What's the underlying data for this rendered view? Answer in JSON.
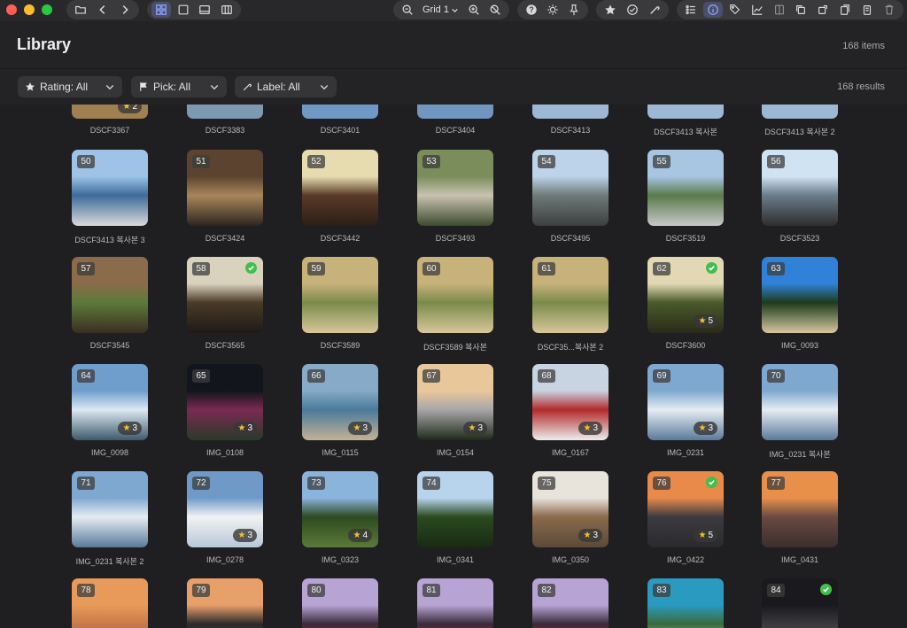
{
  "toolbar": {
    "grid_label": "Grid 1",
    "icons": [
      "folder-icon",
      "back-icon",
      "forward-icon",
      "grid-view-icon",
      "single-view-icon",
      "filmstrip-view-icon",
      "compare-view-icon",
      "zoom-out-icon",
      "zoom-in-icon",
      "zoom-reset-icon",
      "help-icon",
      "brightness-icon",
      "pin-icon",
      "star-icon",
      "check-icon",
      "eyedropper-icon",
      "list-icon",
      "info-icon",
      "tags-icon",
      "histogram-icon",
      "panel-icon",
      "copy-icon",
      "crop-icon",
      "paste-icon",
      "duplicate-icon",
      "trash-icon"
    ]
  },
  "header": {
    "title": "Library",
    "count": "168 items"
  },
  "filters": {
    "rating": "Rating: All",
    "pick": "Pick: All",
    "label": "Label: All",
    "results": "168 results"
  },
  "grid": {
    "partial_row": [
      {
        "name": "DSCF3367",
        "stars": "2",
        "colors": [
          "#6b5a3c",
          "#a08050"
        ]
      },
      {
        "name": "DSCF3383",
        "stars": "",
        "colors": [
          "#4a5f74",
          "#7d9ab3"
        ]
      },
      {
        "name": "DSCF3401",
        "stars": "",
        "colors": [
          "#3f6a95",
          "#6f98c4"
        ]
      },
      {
        "name": "DSCF3404",
        "stars": "",
        "colors": [
          "#3d5f8a",
          "#7197c0"
        ]
      },
      {
        "name": "DSCF3413",
        "stars": "",
        "colors": [
          "#5a7fa3",
          "#9bb9d4"
        ]
      },
      {
        "name": "DSCF3413 복사본",
        "stars": "",
        "colors": [
          "#5a7fa3",
          "#9bb9d4"
        ]
      },
      {
        "name": "DSCF3413 복사본 2",
        "stars": "",
        "colors": [
          "#5a7fa3",
          "#9bb9d4"
        ]
      }
    ],
    "rows": [
      [
        {
          "num": "50",
          "name": "DSCF3413 복사본 3",
          "stars": "",
          "check": false,
          "colors": [
            "#9ec3e6",
            "#3d6b9b",
            "#d9d9d9"
          ]
        },
        {
          "num": "51",
          "name": "DSCF3424",
          "stars": "",
          "check": false,
          "colors": [
            "#5b4330",
            "#a9865a",
            "#2d2520"
          ]
        },
        {
          "num": "52",
          "name": "DSCF3442",
          "stars": "",
          "check": false,
          "colors": [
            "#e6dcb0",
            "#5a3a28",
            "#2b1e17"
          ]
        },
        {
          "num": "53",
          "name": "DSCF3493",
          "stars": "",
          "check": false,
          "colors": [
            "#7a8d5a",
            "#c9c2b0",
            "#3c4a2e"
          ]
        },
        {
          "num": "54",
          "name": "DSCF3495",
          "stars": "",
          "check": false,
          "colors": [
            "#bcd3ea",
            "#6f7a78",
            "#3c3f40"
          ]
        },
        {
          "num": "55",
          "name": "DSCF3519",
          "stars": "",
          "check": false,
          "colors": [
            "#a8c5e2",
            "#5a7a4a",
            "#c8c8c8"
          ]
        },
        {
          "num": "56",
          "name": "DSCF3523",
          "stars": "",
          "check": false,
          "colors": [
            "#cfe3f2",
            "#6a7c8a",
            "#2d2d2d"
          ]
        }
      ],
      [
        {
          "num": "57",
          "name": "DSCF3545",
          "stars": "",
          "check": false,
          "colors": [
            "#8a6b4a",
            "#5c7a3a",
            "#3b2e22"
          ]
        },
        {
          "num": "58",
          "name": "DSCF3565",
          "stars": "",
          "check": true,
          "colors": [
            "#d9d2bd",
            "#4a3a28",
            "#1e1a16"
          ]
        },
        {
          "num": "59",
          "name": "DSCF3589",
          "stars": "",
          "check": false,
          "colors": [
            "#c7b27a",
            "#7a8a4a",
            "#d9c79a"
          ]
        },
        {
          "num": "60",
          "name": "DSCF3589 복사본",
          "stars": "",
          "check": false,
          "colors": [
            "#c7b27a",
            "#7a8a4a",
            "#d9c79a"
          ]
        },
        {
          "num": "61",
          "name": "DSCF35...복사본 2",
          "stars": "",
          "check": false,
          "colors": [
            "#c7b27a",
            "#7a8a4a",
            "#d9c79a"
          ]
        },
        {
          "num": "62",
          "name": "DSCF3600",
          "stars": "5",
          "check": true,
          "colors": [
            "#e2d8b4",
            "#4a5a2a",
            "#2a2a1a"
          ]
        },
        {
          "num": "63",
          "name": "IMG_0093",
          "stars": "",
          "check": false,
          "colors": [
            "#2f82d8",
            "#1d3a1a",
            "#d6c6a0"
          ]
        }
      ],
      [
        {
          "num": "64",
          "name": "IMG_0098",
          "stars": "3",
          "check": false,
          "colors": [
            "#6f9dcc",
            "#dce8f2",
            "#3d5a6a"
          ]
        },
        {
          "num": "65",
          "name": "IMG_0108",
          "stars": "3",
          "check": false,
          "colors": [
            "#12151c",
            "#7a2a52",
            "#2a3a2a"
          ]
        },
        {
          "num": "66",
          "name": "IMG_0115",
          "stars": "3",
          "check": false,
          "colors": [
            "#86aac8",
            "#4a7a9a",
            "#c4b294"
          ]
        },
        {
          "num": "67",
          "name": "IMG_0154",
          "stars": "3",
          "check": false,
          "colors": [
            "#e8c89a",
            "#a8a6a8",
            "#1e2a1a"
          ]
        },
        {
          "num": "68",
          "name": "IMG_0167",
          "stars": "3",
          "check": false,
          "colors": [
            "#c8d4e2",
            "#b22a2a",
            "#ededed"
          ]
        },
        {
          "num": "69",
          "name": "IMG_0231",
          "stars": "3",
          "check": false,
          "colors": [
            "#7fa8d0",
            "#e6ecf2",
            "#5a7a9a"
          ]
        },
        {
          "num": "70",
          "name": "IMG_0231 복사본",
          "stars": "",
          "check": false,
          "colors": [
            "#7fa8d0",
            "#e6ecf2",
            "#5a7a9a"
          ]
        }
      ],
      [
        {
          "num": "71",
          "name": "IMG_0231 복사본 2",
          "stars": "",
          "check": false,
          "colors": [
            "#7fa8d0",
            "#e6ecf2",
            "#5a7a9a"
          ]
        },
        {
          "num": "72",
          "name": "IMG_0278",
          "stars": "3",
          "check": false,
          "colors": [
            "#6f9ac8",
            "#f2f2f2",
            "#b8c8d8"
          ]
        },
        {
          "num": "73",
          "name": "IMG_0323",
          "stars": "4",
          "check": false,
          "colors": [
            "#8ab4dc",
            "#2d4a1e",
            "#5a7a3a"
          ]
        },
        {
          "num": "74",
          "name": "IMG_0341",
          "stars": "",
          "check": false,
          "colors": [
            "#b8d4ec",
            "#2a4a1e",
            "#1a2a14"
          ]
        },
        {
          "num": "75",
          "name": "IMG_0350",
          "stars": "3",
          "check": false,
          "colors": [
            "#e8e4dc",
            "#8a6a4a",
            "#5a4a3a"
          ]
        },
        {
          "num": "76",
          "name": "IMG_0422",
          "stars": "5",
          "check": true,
          "colors": [
            "#e88a4a",
            "#3a3a40",
            "#2a2a2e"
          ]
        },
        {
          "num": "77",
          "name": "IMG_0431",
          "stars": "",
          "check": false,
          "colors": [
            "#e8904a",
            "#6a4a42",
            "#3a2e2e"
          ]
        }
      ],
      [
        {
          "num": "78",
          "name": "",
          "stars": "",
          "check": false,
          "colors": [
            "#e89a5a",
            "#c87a4a",
            "#6a5a6a"
          ]
        },
        {
          "num": "79",
          "name": "",
          "stars": "",
          "check": false,
          "colors": [
            "#e8a06a",
            "#2a2a2a",
            "#5a4a3a"
          ]
        },
        {
          "num": "80",
          "name": "",
          "stars": "",
          "check": false,
          "colors": [
            "#b8a4d4",
            "#3a2a3a",
            "#c83a3a"
          ]
        },
        {
          "num": "81",
          "name": "",
          "stars": "",
          "check": false,
          "colors": [
            "#b8a4d4",
            "#3a2a3a",
            "#c83a3a"
          ]
        },
        {
          "num": "82",
          "name": "",
          "stars": "",
          "check": false,
          "colors": [
            "#b8a4d4",
            "#3a2a3a",
            "#c83a3a"
          ]
        },
        {
          "num": "83",
          "name": "",
          "stars": "",
          "check": false,
          "colors": [
            "#2a9ac0",
            "#3a6a3a",
            "#e8f0f2"
          ]
        },
        {
          "num": "84",
          "name": "",
          "stars": "",
          "check": true,
          "colors": [
            "#1a1a1e",
            "#3a3a3e",
            "#6a6a6a"
          ]
        }
      ]
    ]
  }
}
